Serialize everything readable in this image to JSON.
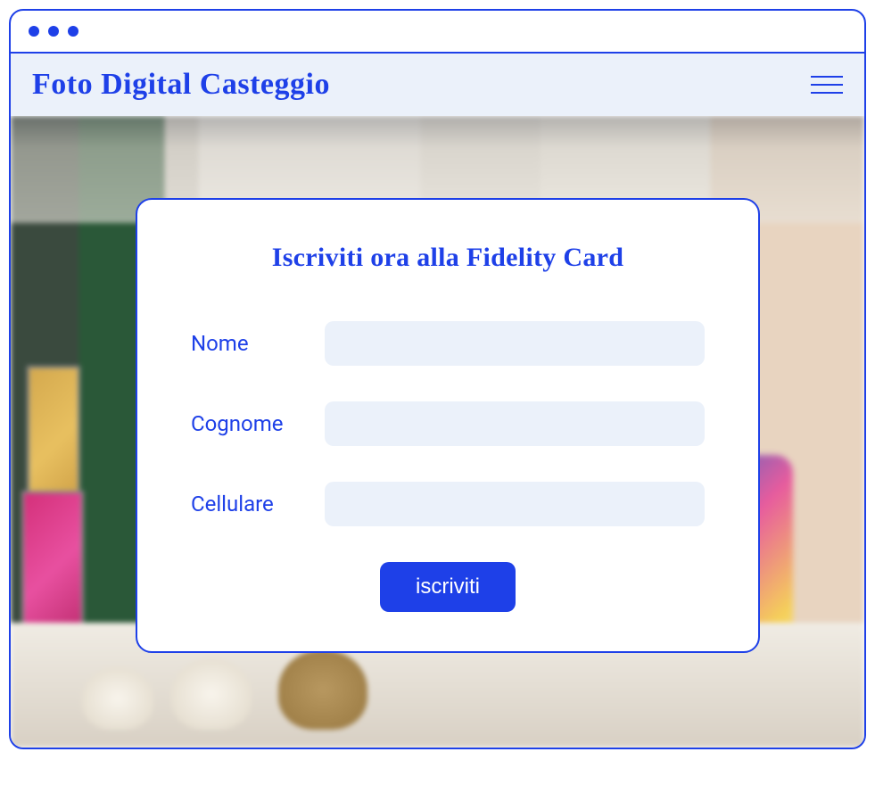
{
  "header": {
    "site_title": "Foto Digital Casteggio"
  },
  "form": {
    "title": "Iscriviti ora alla Fidelity Card",
    "fields": {
      "nome": {
        "label": "Nome",
        "value": ""
      },
      "cognome": {
        "label": "Cognome",
        "value": ""
      },
      "cellulare": {
        "label": "Cellulare",
        "value": ""
      }
    },
    "submit_label": "iscriviti"
  }
}
